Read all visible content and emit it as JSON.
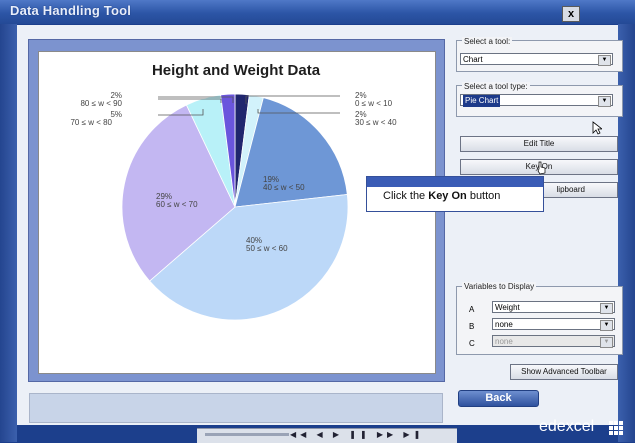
{
  "window": {
    "title": "Data Handling Tool",
    "close_label": "x"
  },
  "chart": {
    "title": "Height and Weight Data",
    "labels": {
      "s1_pct": "2%",
      "s1_cat": "0 ≤ w < 10",
      "s2_pct": "2%",
      "s2_cat": "30 ≤ w < 40",
      "s3_pct": "19%",
      "s3_cat": "40 ≤ w < 50",
      "s4_pct": "40%",
      "s4_cat": "50 ≤ w < 60",
      "s5_pct": "29%",
      "s5_cat": "60 ≤ w < 70",
      "s6_pct": "5%",
      "s6_cat": "70 ≤ w < 80",
      "s7_pct": "2%",
      "s7_cat": "80 ≤ w < 90"
    }
  },
  "chart_data": {
    "type": "pie",
    "title": "Height and Weight Data",
    "categories": [
      "0 ≤ w < 10",
      "30 ≤ w < 40",
      "40 ≤ w < 50",
      "50 ≤ w < 60",
      "60 ≤ w < 70",
      "70 ≤ w < 80",
      "80 ≤ w < 90"
    ],
    "values": [
      2,
      2,
      19,
      40,
      29,
      5,
      2
    ],
    "colors": [
      "#20266e",
      "#d2f2fb",
      "#6e97d6",
      "#bcd8f8",
      "#c3b7f2",
      "#b8f1f8",
      "#6a55dd"
    ]
  },
  "panel": {
    "tool_label": "Select a tool:",
    "tool_value": "Chart",
    "type_label": "Select a tool type:",
    "type_value": "Pie Chart",
    "edit_title": "Edit Title",
    "key_on": "Key On",
    "clipboard": "lipboard",
    "variables_label": "Variables to Display",
    "var_a_letter": "A",
    "var_a_value": "Weight",
    "var_b_letter": "B",
    "var_b_value": "none",
    "var_c_letter": "C",
    "var_c_value": "none",
    "advanced": "Show Advanced Toolbar",
    "back": "Back"
  },
  "tooltip": {
    "pre": "Click the ",
    "bold": "Key On",
    "post": " button"
  },
  "branding": {
    "logo": "edexcel"
  },
  "player": {
    "controls": "◀◀ ◀ ▶ ❚❚ ▶▶ ▶❚"
  }
}
